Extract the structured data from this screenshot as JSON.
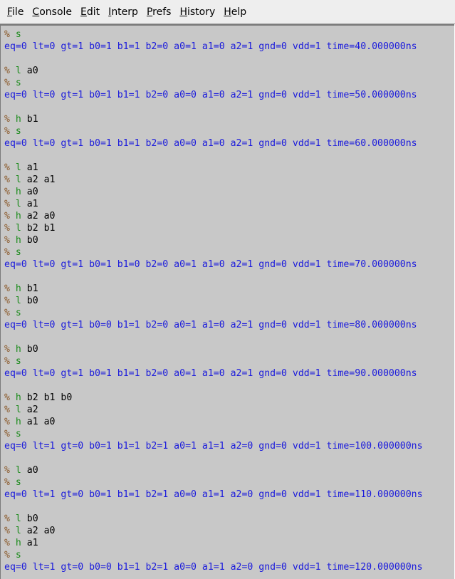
{
  "menubar": {
    "items": [
      {
        "mnemonic": "F",
        "rest": "ile"
      },
      {
        "mnemonic": "C",
        "rest": "onsole"
      },
      {
        "mnemonic": "E",
        "rest": "dit"
      },
      {
        "mnemonic": "I",
        "rest": "nterp"
      },
      {
        "mnemonic": "P",
        "rest": "refs"
      },
      {
        "mnemonic": "H",
        "rest": "istory"
      },
      {
        "mnemonic": "H",
        "rest": "elp"
      }
    ]
  },
  "console": {
    "prompt_symbol": "%",
    "lines": [
      {
        "kind": "cmd",
        "verb": "s",
        "args": ""
      },
      {
        "kind": "out",
        "text": "eq=0 lt=0 gt=1 b0=1 b1=1 b2=0 a0=1 a1=0 a2=1 gnd=0 vdd=1 time=40.000000ns"
      },
      {
        "kind": "blank"
      },
      {
        "kind": "cmd",
        "verb": "l",
        "args": " a0"
      },
      {
        "kind": "cmd",
        "verb": "s",
        "args": ""
      },
      {
        "kind": "out",
        "text": "eq=0 lt=0 gt=1 b0=1 b1=1 b2=0 a0=0 a1=0 a2=1 gnd=0 vdd=1 time=50.000000ns"
      },
      {
        "kind": "blank"
      },
      {
        "kind": "cmd",
        "verb": "h",
        "args": " b1"
      },
      {
        "kind": "cmd",
        "verb": "s",
        "args": ""
      },
      {
        "kind": "out",
        "text": "eq=0 lt=0 gt=1 b0=1 b1=1 b2=0 a0=0 a1=0 a2=1 gnd=0 vdd=1 time=60.000000ns"
      },
      {
        "kind": "blank"
      },
      {
        "kind": "cmd",
        "verb": "l",
        "args": " a1"
      },
      {
        "kind": "cmd",
        "verb": "l",
        "args": " a2 a1"
      },
      {
        "kind": "cmd",
        "verb": "h",
        "args": " a0"
      },
      {
        "kind": "cmd",
        "verb": "l",
        "args": " a1"
      },
      {
        "kind": "cmd",
        "verb": "h",
        "args": " a2 a0"
      },
      {
        "kind": "cmd",
        "verb": "l",
        "args": " b2 b1"
      },
      {
        "kind": "cmd",
        "verb": "h",
        "args": " b0"
      },
      {
        "kind": "cmd",
        "verb": "s",
        "args": ""
      },
      {
        "kind": "out",
        "text": "eq=0 lt=0 gt=1 b0=1 b1=0 b2=0 a0=1 a1=0 a2=1 gnd=0 vdd=1 time=70.000000ns"
      },
      {
        "kind": "blank"
      },
      {
        "kind": "cmd",
        "verb": "h",
        "args": " b1"
      },
      {
        "kind": "cmd",
        "verb": "l",
        "args": " b0"
      },
      {
        "kind": "cmd",
        "verb": "s",
        "args": ""
      },
      {
        "kind": "out",
        "text": "eq=0 lt=0 gt=1 b0=0 b1=1 b2=0 a0=1 a1=0 a2=1 gnd=0 vdd=1 time=80.000000ns"
      },
      {
        "kind": "blank"
      },
      {
        "kind": "cmd",
        "verb": "h",
        "args": " b0"
      },
      {
        "kind": "cmd",
        "verb": "s",
        "args": ""
      },
      {
        "kind": "out",
        "text": "eq=0 lt=0 gt=1 b0=1 b1=1 b2=0 a0=1 a1=0 a2=1 gnd=0 vdd=1 time=90.000000ns"
      },
      {
        "kind": "blank"
      },
      {
        "kind": "cmd",
        "verb": "h",
        "args": " b2 b1 b0"
      },
      {
        "kind": "cmd",
        "verb": "l",
        "args": " a2"
      },
      {
        "kind": "cmd",
        "verb": "h",
        "args": " a1 a0"
      },
      {
        "kind": "cmd",
        "verb": "s",
        "args": ""
      },
      {
        "kind": "out",
        "text": "eq=0 lt=1 gt=0 b0=1 b1=1 b2=1 a0=1 a1=1 a2=0 gnd=0 vdd=1 time=100.000000ns"
      },
      {
        "kind": "blank"
      },
      {
        "kind": "cmd",
        "verb": "l",
        "args": " a0"
      },
      {
        "kind": "cmd",
        "verb": "s",
        "args": ""
      },
      {
        "kind": "out",
        "text": "eq=0 lt=1 gt=0 b0=1 b1=1 b2=1 a0=0 a1=1 a2=0 gnd=0 vdd=1 time=110.000000ns"
      },
      {
        "kind": "blank"
      },
      {
        "kind": "cmd",
        "verb": "l",
        "args": " b0"
      },
      {
        "kind": "cmd",
        "verb": "l",
        "args": " a2 a0"
      },
      {
        "kind": "cmd",
        "verb": "h",
        "args": " a1"
      },
      {
        "kind": "cmd",
        "verb": "s",
        "args": ""
      },
      {
        "kind": "out",
        "text": "eq=0 lt=1 gt=0 b0=0 b1=1 b2=1 a0=0 a1=1 a2=0 gnd=0 vdd=1 time=120.000000ns"
      }
    ]
  },
  "colors": {
    "background": "#c8c8c8",
    "menubar": "#eeeeee",
    "prompt": "#8b5a2b",
    "command": "#1a8a1a",
    "output": "#1a1adc"
  }
}
